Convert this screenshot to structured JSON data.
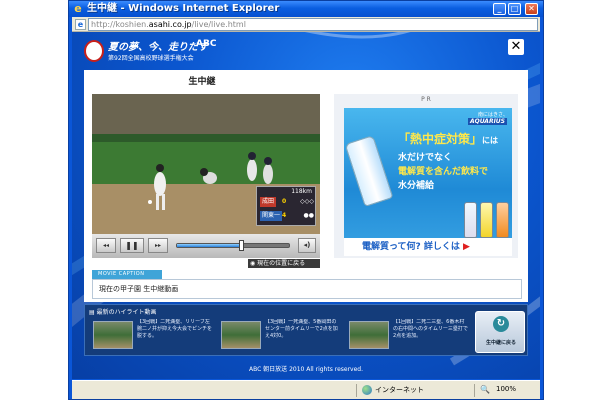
{
  "window": {
    "title": "生中継 - Windows Internet Explorer",
    "minimize_glyph": "_",
    "maximize_glyph": "□",
    "close_glyph": "✕"
  },
  "address": {
    "prefix": "http://koshien.",
    "host": "asahi.co.jp",
    "path": "/live/live.html"
  },
  "header": {
    "logo_main": "夏の夢、今、走りだす",
    "logo_abc": "ABC",
    "logo_sub": "第92回全国高校野球選手権大会",
    "close_glyph": "✕"
  },
  "live": {
    "title": "生中継",
    "current_position_label": "現在の位置に戻る",
    "seek_progress": 0.58,
    "controls": {
      "rewind": "◂◂",
      "pause": "❚❚",
      "forward": "▸▸",
      "volume": "◂)"
    }
  },
  "scoreboard": {
    "time": "118km",
    "team_a": "成田",
    "score_a": "0",
    "team_b": "関東一",
    "score_b": "4",
    "bases_a": "◇◇◇",
    "bases_b": "●●"
  },
  "ad": {
    "pr_label": "P R",
    "tagline": "南にはきさ、",
    "brand": "AQUARIUS",
    "headline_hl": "「熱中症対策」",
    "headline_suffix": "には",
    "line2": "水だけでなく",
    "line3": "電解質を含んだ飲料で",
    "line4": "水分補給",
    "footer": "電解質って何? 詳しくは",
    "footer_arrow": "▶"
  },
  "caption": {
    "tab_label": "MOVIE CAPTION",
    "text": "現在の甲子園 生中継動画"
  },
  "highlights": {
    "header": "最新のハイライト動画",
    "items": [
      {
        "text": "【3回戦】二死満塁、リリーフ左腕二ノ井が抑え今大会でピンチを脱する。"
      },
      {
        "text": "【3回戦】一死満塁、5番岡田のセンター前タイムリーで2点を加え4対0。"
      },
      {
        "text": "【1回戦】二死二三塁、6番木村の右中間へのタイムリー三塁打で2点を追加。"
      }
    ],
    "back_icon": "↻",
    "back_label": "生中継に戻る"
  },
  "copyright": "ABC 朝日放送 2010 All rights reserved.",
  "status": {
    "zone": "インターネット",
    "zoom_icon": "🔍",
    "zoom": "100%"
  },
  "colors": {
    "page_blue": "#0b56cf",
    "titlebar": "#0a5ee0",
    "caption_tab": "#3fa4d8"
  }
}
